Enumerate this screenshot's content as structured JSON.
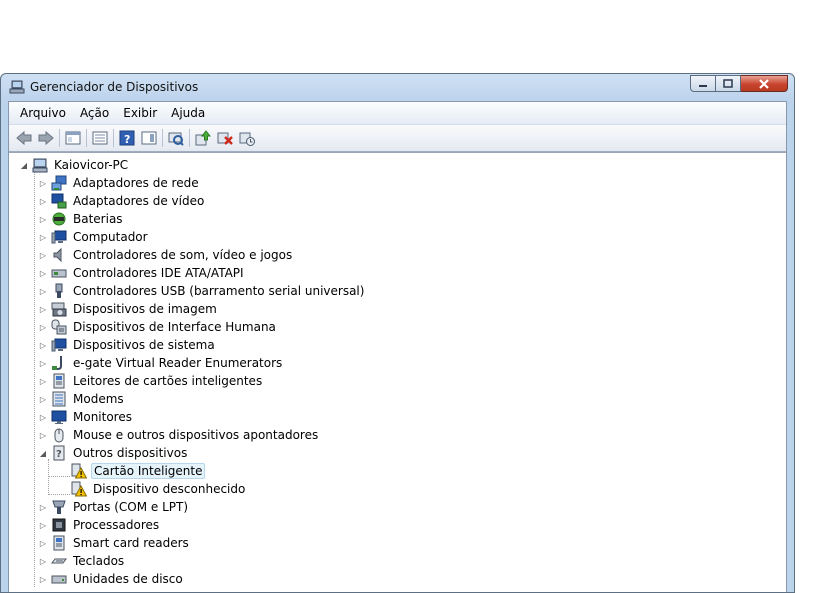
{
  "window": {
    "title": "Gerenciador de Dispositivos"
  },
  "menu": [
    "Arquivo",
    "Ação",
    "Exibir",
    "Ajuda"
  ],
  "toolbar": {
    "buttons": [
      "back-icon",
      "forward-icon",
      "properties-panel-icon",
      "device-list-icon",
      "help-icon",
      "action-pane-icon",
      "scan-hardware-icon",
      "update-driver-icon",
      "uninstall-icon",
      "disable-icon"
    ]
  },
  "tree": {
    "root": "Kaiovicor-PC",
    "categories": [
      {
        "label": "Adaptadores de rede",
        "icon": "network-adapter-icon"
      },
      {
        "label": "Adaptadores de vídeo",
        "icon": "display-adapter-icon"
      },
      {
        "label": "Baterias",
        "icon": "battery-icon"
      },
      {
        "label": "Computador",
        "icon": "computer-icon"
      },
      {
        "label": "Controladores de som, vídeo e jogos",
        "icon": "speaker-icon"
      },
      {
        "label": "Controladores IDE ATA/ATAPI",
        "icon": "ide-controller-icon"
      },
      {
        "label": "Controladores USB (barramento serial universal)",
        "icon": "usb-icon"
      },
      {
        "label": "Dispositivos de imagem",
        "icon": "camera-icon"
      },
      {
        "label": "Dispositivos de Interface Humana",
        "icon": "hid-icon"
      },
      {
        "label": "Dispositivos de sistema",
        "icon": "system-device-icon"
      },
      {
        "label": "e-gate Virtual Reader Enumerators",
        "icon": "egate-icon"
      },
      {
        "label": "Leitores de cartões inteligentes",
        "icon": "smartcard-reader-icon"
      },
      {
        "label": "Modems",
        "icon": "modem-icon"
      },
      {
        "label": "Monitores",
        "icon": "monitor-icon"
      },
      {
        "label": "Mouse e outros dispositivos apontadores",
        "icon": "mouse-icon"
      },
      {
        "label": "Outros dispositivos",
        "icon": "unknown-device-icon",
        "expanded": true,
        "children": [
          {
            "label": "Cartão Inteligente",
            "icon": "warning-device-icon",
            "selected": true
          },
          {
            "label": "Dispositivo desconhecido",
            "icon": "warning-device-icon"
          }
        ]
      },
      {
        "label": "Portas (COM e LPT)",
        "icon": "port-icon"
      },
      {
        "label": "Processadores",
        "icon": "processor-icon"
      },
      {
        "label": "Smart card readers",
        "icon": "smartcard-reader-icon"
      },
      {
        "label": "Teclados",
        "icon": "keyboard-icon"
      },
      {
        "label": "Unidades de disco",
        "icon": "disk-drive-icon"
      }
    ]
  }
}
